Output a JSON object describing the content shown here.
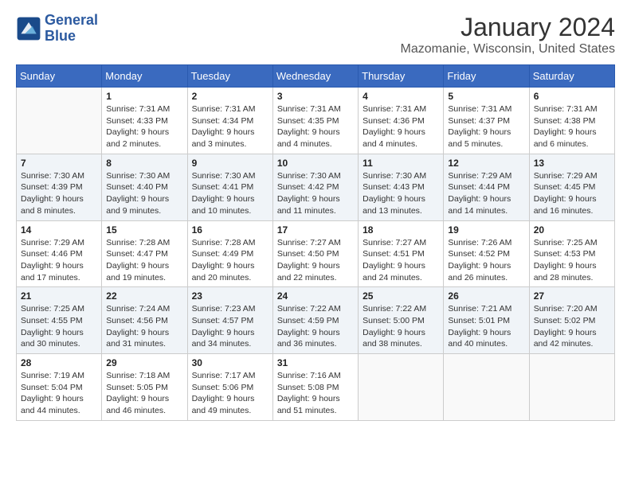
{
  "header": {
    "logo_line1": "General",
    "logo_line2": "Blue",
    "month": "January 2024",
    "location": "Mazomanie, Wisconsin, United States"
  },
  "weekdays": [
    "Sunday",
    "Monday",
    "Tuesday",
    "Wednesday",
    "Thursday",
    "Friday",
    "Saturday"
  ],
  "weeks": [
    [
      {
        "day": "",
        "sunrise": "",
        "sunset": "",
        "daylight": ""
      },
      {
        "day": "1",
        "sunrise": "Sunrise: 7:31 AM",
        "sunset": "Sunset: 4:33 PM",
        "daylight": "Daylight: 9 hours and 2 minutes."
      },
      {
        "day": "2",
        "sunrise": "Sunrise: 7:31 AM",
        "sunset": "Sunset: 4:34 PM",
        "daylight": "Daylight: 9 hours and 3 minutes."
      },
      {
        "day": "3",
        "sunrise": "Sunrise: 7:31 AM",
        "sunset": "Sunset: 4:35 PM",
        "daylight": "Daylight: 9 hours and 4 minutes."
      },
      {
        "day": "4",
        "sunrise": "Sunrise: 7:31 AM",
        "sunset": "Sunset: 4:36 PM",
        "daylight": "Daylight: 9 hours and 4 minutes."
      },
      {
        "day": "5",
        "sunrise": "Sunrise: 7:31 AM",
        "sunset": "Sunset: 4:37 PM",
        "daylight": "Daylight: 9 hours and 5 minutes."
      },
      {
        "day": "6",
        "sunrise": "Sunrise: 7:31 AM",
        "sunset": "Sunset: 4:38 PM",
        "daylight": "Daylight: 9 hours and 6 minutes."
      }
    ],
    [
      {
        "day": "7",
        "sunrise": "Sunrise: 7:30 AM",
        "sunset": "Sunset: 4:39 PM",
        "daylight": "Daylight: 9 hours and 8 minutes."
      },
      {
        "day": "8",
        "sunrise": "Sunrise: 7:30 AM",
        "sunset": "Sunset: 4:40 PM",
        "daylight": "Daylight: 9 hours and 9 minutes."
      },
      {
        "day": "9",
        "sunrise": "Sunrise: 7:30 AM",
        "sunset": "Sunset: 4:41 PM",
        "daylight": "Daylight: 9 hours and 10 minutes."
      },
      {
        "day": "10",
        "sunrise": "Sunrise: 7:30 AM",
        "sunset": "Sunset: 4:42 PM",
        "daylight": "Daylight: 9 hours and 11 minutes."
      },
      {
        "day": "11",
        "sunrise": "Sunrise: 7:30 AM",
        "sunset": "Sunset: 4:43 PM",
        "daylight": "Daylight: 9 hours and 13 minutes."
      },
      {
        "day": "12",
        "sunrise": "Sunrise: 7:29 AM",
        "sunset": "Sunset: 4:44 PM",
        "daylight": "Daylight: 9 hours and 14 minutes."
      },
      {
        "day": "13",
        "sunrise": "Sunrise: 7:29 AM",
        "sunset": "Sunset: 4:45 PM",
        "daylight": "Daylight: 9 hours and 16 minutes."
      }
    ],
    [
      {
        "day": "14",
        "sunrise": "Sunrise: 7:29 AM",
        "sunset": "Sunset: 4:46 PM",
        "daylight": "Daylight: 9 hours and 17 minutes."
      },
      {
        "day": "15",
        "sunrise": "Sunrise: 7:28 AM",
        "sunset": "Sunset: 4:47 PM",
        "daylight": "Daylight: 9 hours and 19 minutes."
      },
      {
        "day": "16",
        "sunrise": "Sunrise: 7:28 AM",
        "sunset": "Sunset: 4:49 PM",
        "daylight": "Daylight: 9 hours and 20 minutes."
      },
      {
        "day": "17",
        "sunrise": "Sunrise: 7:27 AM",
        "sunset": "Sunset: 4:50 PM",
        "daylight": "Daylight: 9 hours and 22 minutes."
      },
      {
        "day": "18",
        "sunrise": "Sunrise: 7:27 AM",
        "sunset": "Sunset: 4:51 PM",
        "daylight": "Daylight: 9 hours and 24 minutes."
      },
      {
        "day": "19",
        "sunrise": "Sunrise: 7:26 AM",
        "sunset": "Sunset: 4:52 PM",
        "daylight": "Daylight: 9 hours and 26 minutes."
      },
      {
        "day": "20",
        "sunrise": "Sunrise: 7:25 AM",
        "sunset": "Sunset: 4:53 PM",
        "daylight": "Daylight: 9 hours and 28 minutes."
      }
    ],
    [
      {
        "day": "21",
        "sunrise": "Sunrise: 7:25 AM",
        "sunset": "Sunset: 4:55 PM",
        "daylight": "Daylight: 9 hours and 30 minutes."
      },
      {
        "day": "22",
        "sunrise": "Sunrise: 7:24 AM",
        "sunset": "Sunset: 4:56 PM",
        "daylight": "Daylight: 9 hours and 31 minutes."
      },
      {
        "day": "23",
        "sunrise": "Sunrise: 7:23 AM",
        "sunset": "Sunset: 4:57 PM",
        "daylight": "Daylight: 9 hours and 34 minutes."
      },
      {
        "day": "24",
        "sunrise": "Sunrise: 7:22 AM",
        "sunset": "Sunset: 4:59 PM",
        "daylight": "Daylight: 9 hours and 36 minutes."
      },
      {
        "day": "25",
        "sunrise": "Sunrise: 7:22 AM",
        "sunset": "Sunset: 5:00 PM",
        "daylight": "Daylight: 9 hours and 38 minutes."
      },
      {
        "day": "26",
        "sunrise": "Sunrise: 7:21 AM",
        "sunset": "Sunset: 5:01 PM",
        "daylight": "Daylight: 9 hours and 40 minutes."
      },
      {
        "day": "27",
        "sunrise": "Sunrise: 7:20 AM",
        "sunset": "Sunset: 5:02 PM",
        "daylight": "Daylight: 9 hours and 42 minutes."
      }
    ],
    [
      {
        "day": "28",
        "sunrise": "Sunrise: 7:19 AM",
        "sunset": "Sunset: 5:04 PM",
        "daylight": "Daylight: 9 hours and 44 minutes."
      },
      {
        "day": "29",
        "sunrise": "Sunrise: 7:18 AM",
        "sunset": "Sunset: 5:05 PM",
        "daylight": "Daylight: 9 hours and 46 minutes."
      },
      {
        "day": "30",
        "sunrise": "Sunrise: 7:17 AM",
        "sunset": "Sunset: 5:06 PM",
        "daylight": "Daylight: 9 hours and 49 minutes."
      },
      {
        "day": "31",
        "sunrise": "Sunrise: 7:16 AM",
        "sunset": "Sunset: 5:08 PM",
        "daylight": "Daylight: 9 hours and 51 minutes."
      },
      {
        "day": "",
        "sunrise": "",
        "sunset": "",
        "daylight": ""
      },
      {
        "day": "",
        "sunrise": "",
        "sunset": "",
        "daylight": ""
      },
      {
        "day": "",
        "sunrise": "",
        "sunset": "",
        "daylight": ""
      }
    ]
  ]
}
